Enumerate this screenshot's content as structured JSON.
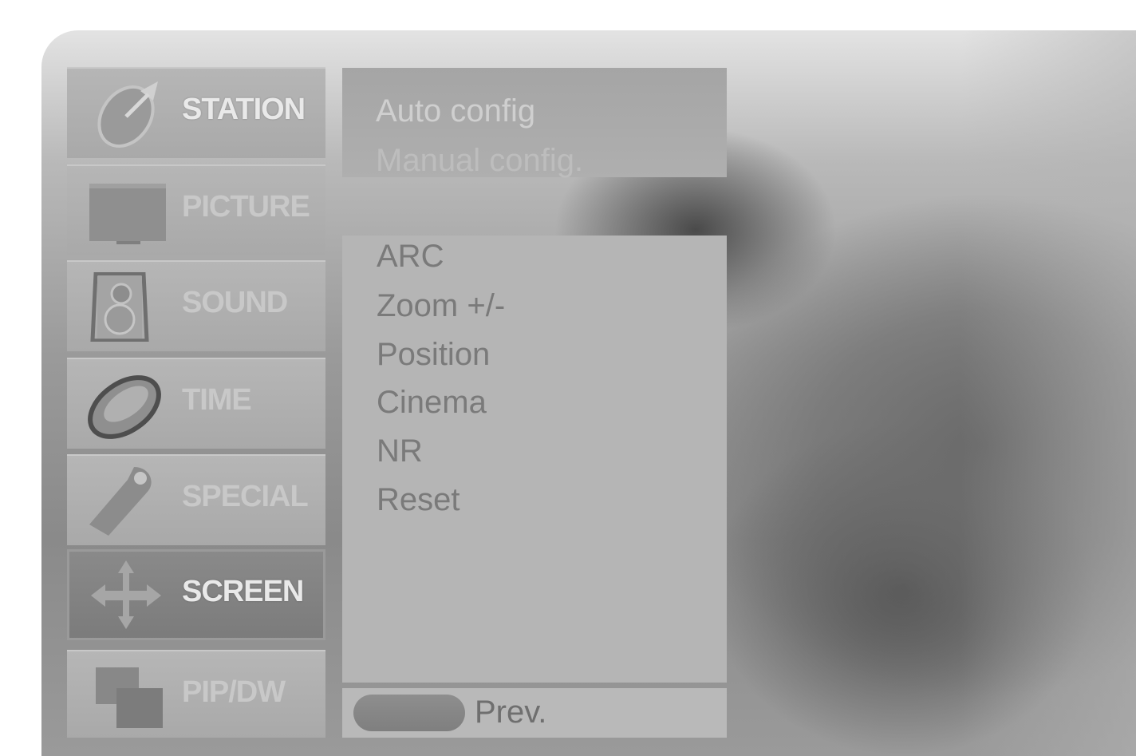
{
  "menu": {
    "items": [
      {
        "label": "STATION",
        "icon": "satellite-dish-icon",
        "active": false
      },
      {
        "label": "PICTURE",
        "icon": "tv-screen-icon",
        "active": false
      },
      {
        "label": "SOUND",
        "icon": "speaker-icon",
        "active": false
      },
      {
        "label": "TIME",
        "icon": "clock-icon",
        "active": false
      },
      {
        "label": "SPECIAL",
        "icon": "tag-icon",
        "active": false
      },
      {
        "label": "SCREEN",
        "icon": "move-arrows-icon",
        "active": true
      },
      {
        "label": "PIP/DW",
        "icon": "pip-windows-icon",
        "active": false
      }
    ]
  },
  "station_submenu": {
    "options": [
      "Auto config",
      "Manual config."
    ]
  },
  "screen_submenu": {
    "options": [
      "ARC",
      "Zoom +/-",
      "Position",
      "Cinema",
      "NR",
      "Reset"
    ]
  },
  "bottom_bar": {
    "prev_label": "Prev."
  }
}
